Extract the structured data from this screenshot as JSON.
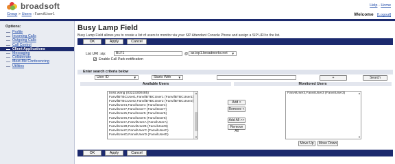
{
  "header": {
    "logo_text": "broadsoft",
    "logo_colors": [
      "#e8872c",
      "#e23a3a",
      "#f2c230",
      "#7ab648"
    ],
    "breadcrumb": {
      "group": "Group",
      "sep1": " > ",
      "users": "Users",
      "sep2": " : ",
      "user": "FanvilUser1"
    },
    "help": "Help",
    "home": "Home",
    "link_sep": " - ",
    "welcome": "Welcome",
    "logout": "[Logout]"
  },
  "sidebar": {
    "title": "Options:",
    "items": [
      {
        "label": "Profile"
      },
      {
        "label": "Incoming Calls"
      },
      {
        "label": "Outgoing Calls"
      },
      {
        "label": "Call Control"
      },
      {
        "label": "Client Applications"
      },
      {
        "label": "Messaging"
      },
      {
        "label": "Collaborate"
      },
      {
        "label": "Meet-Me Conferencing"
      },
      {
        "label": "Utilities"
      }
    ]
  },
  "main": {
    "title": "Busy Lamp Field",
    "description": "Busy Lamp Field allows you to create a list of users to monitor via your SIP Attendant Console Phone and assign a SIP URI to the list.",
    "buttons": {
      "ok": "OK",
      "apply": "Apply",
      "cancel": "Cancel"
    },
    "list_uri_label": "List URI: sip:",
    "list_uri_value": "BLF1",
    "at_sign": "@",
    "domain_value": "as.iop1.broadworks.net",
    "call_park_label": "Enable Call Park notification",
    "call_park_checked": "✔",
    "search_header": "Enter search criteria below",
    "search_field": "User ID",
    "search_mode": "Starts With",
    "search_value": "",
    "plus_label": "+",
    "search_button": "Search",
    "available_header": "Available Users",
    "monitored_header": "Monitored Users",
    "available_users": [
      "boss.wang (03223300485)",
      "FanvilBTBCUser1,FanvilBTBCUser1 (FanvilBTBCUser1)",
      "FanvilBTBCUser2,FanvilBTBCUser2 (FanvilBTBCUser2)",
      "FanvilUser4,FanvilUser4 (FanvilUser4)",
      "FanvilUser7,FanvilUser7 (FanvilUser7)",
      "FanvilUser5,FanvilUser5 (FanvilUser5)",
      "FanvilUser6,FanvilUser6 (FanvilUser6)",
      "FanvilUserA,FanvilUserA (FanvilUserA)",
      "FanvilUserB,FanvilUserB (FanvilUserB)",
      "FanvilUserC,FanvilUserC (FanvilUserC)",
      "FanvilUserD,FanvilUserD (FanvilUserD)"
    ],
    "monitored_users": [
      "FanvilUser3,FanvilUser3 (FanvilUser3)"
    ],
    "add": "Add >",
    "remove": "Remove <",
    "add_all": "Add All >>",
    "remove_all": "Remove All",
    "move_up": "Move Up",
    "move_down": "Move Down"
  }
}
